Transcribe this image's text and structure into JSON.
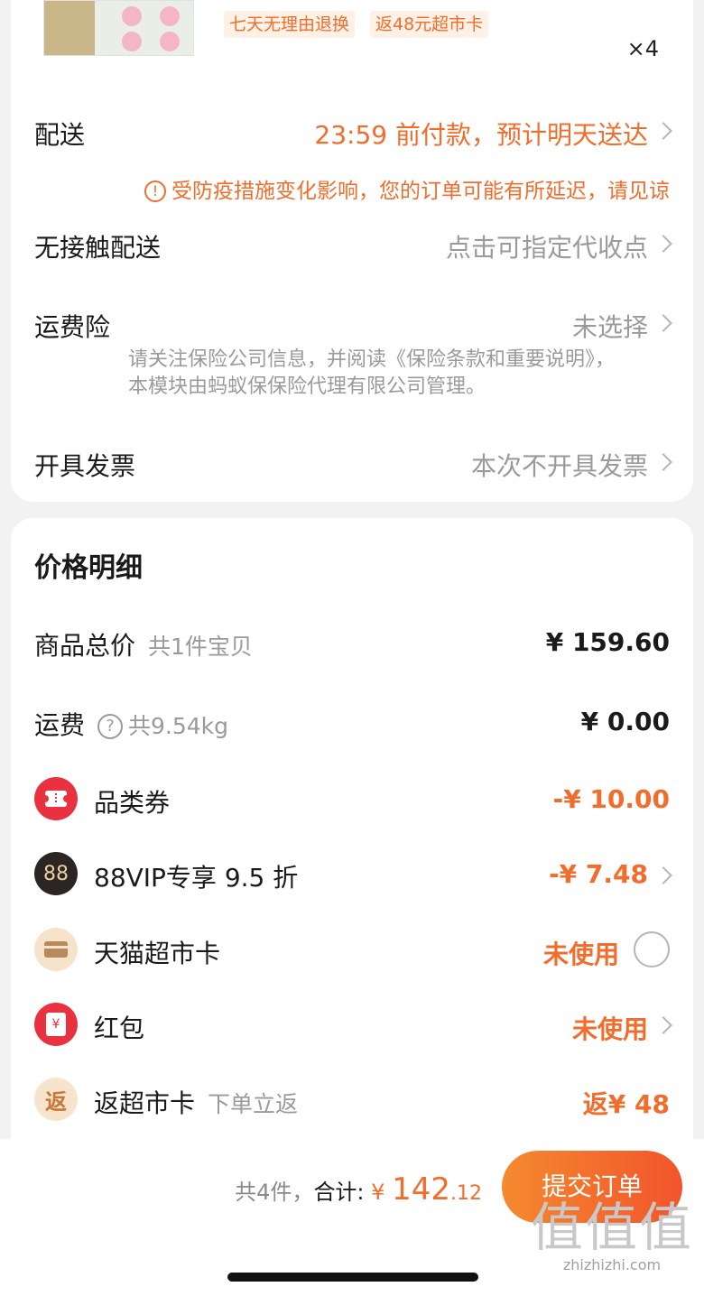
{
  "product": {
    "tags": [
      "七天无理由退换",
      "返48元超市卡"
    ],
    "quantity": "×4"
  },
  "order_options": {
    "delivery": {
      "label": "配送",
      "value": "23:59 前付款，预计明天送达"
    },
    "delay_notice": "受防疫措施变化影响，您的订单可能有所延迟，请见谅",
    "contactless": {
      "label": "无接触配送",
      "value": "点击可指定代收点"
    },
    "shipping_insurance": {
      "label": "运费险",
      "value": "未选择",
      "note": "请关注保险公司信息，并阅读《保险条款和重要说明》，本模块由蚂蚁保保险代理有限公司管理。"
    },
    "invoice": {
      "label": "开具发票",
      "value": "本次不开具发票"
    }
  },
  "price_detail": {
    "title": "价格明细",
    "subtotal": {
      "label": "商品总价",
      "sub": "共1件宝贝",
      "amount": "¥ 159.60"
    },
    "shipping": {
      "label": "运费",
      "sub": "共9.54kg",
      "amount": "¥ 0.00"
    },
    "category_coupon": {
      "label": "品类券",
      "amount": "-¥ 10.00"
    },
    "vip": {
      "icon_text": "88",
      "label": "88VIP专享 9.5 折",
      "amount": "-¥ 7.48"
    },
    "tmall_card": {
      "label": "天猫超市卡",
      "status": "未使用"
    },
    "red_packet": {
      "icon_text": "¥",
      "label": "红包",
      "status": "未使用"
    },
    "rebate_card": {
      "icon_text": "返",
      "label": "返超市卡",
      "sub": "下单立返",
      "amount": "返¥ 48"
    }
  },
  "checkout": {
    "count_text": "共4件，",
    "total_label": "合计:",
    "currency": "¥",
    "total_int": "142",
    "total_dec": ".12",
    "submit_label": "提交订单"
  },
  "watermark": {
    "big": "值值值",
    "small": "zhizhizhi.com"
  },
  "colors": {
    "accent": "#f26d2b",
    "background": "#f2f2f2",
    "card": "#ffffff"
  }
}
